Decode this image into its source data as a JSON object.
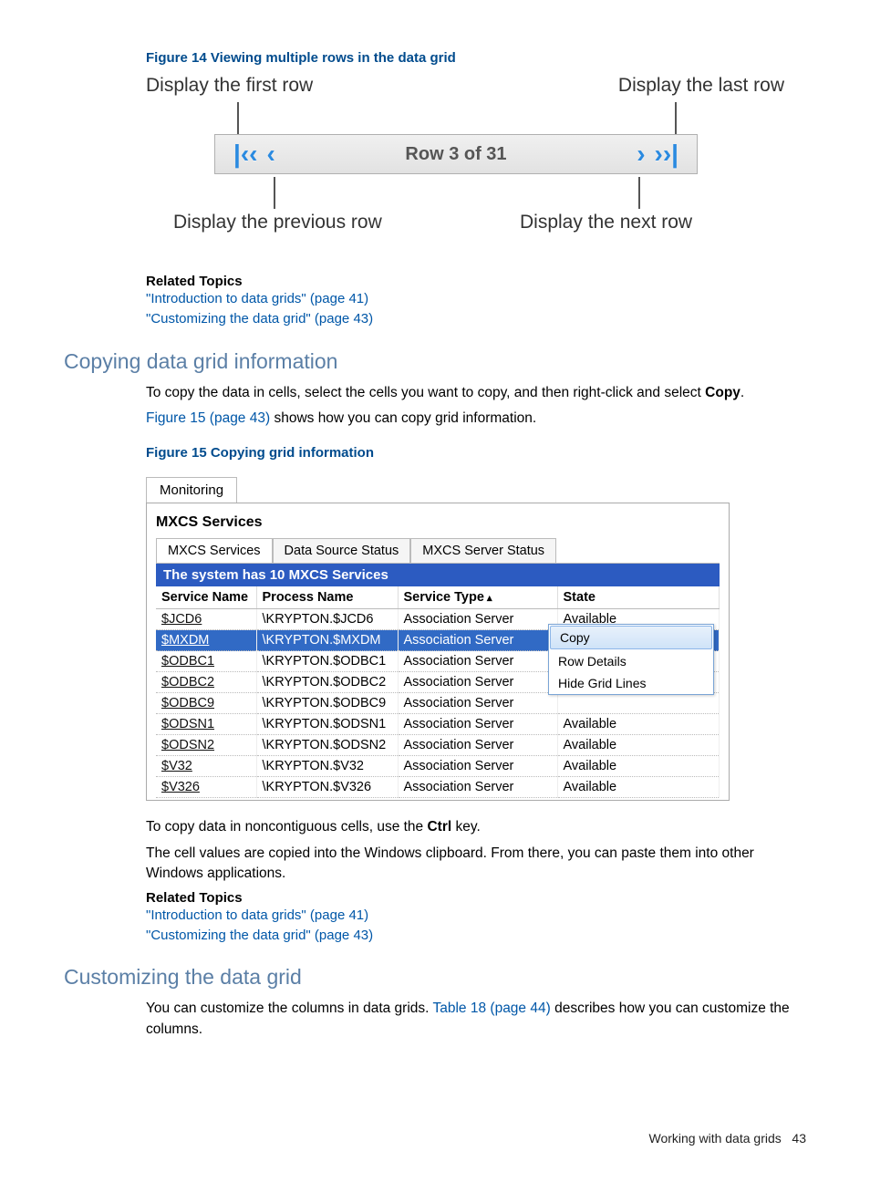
{
  "figure14": {
    "caption": "Figure 14 Viewing multiple rows in the data grid",
    "label_first": "Display the first row",
    "label_last": "Display the last row",
    "label_prev": "Display the previous row",
    "label_next": "Display the next row",
    "row_text": "Row 3 of 31"
  },
  "related1": {
    "heading": "Related Topics",
    "link1": "\"Introduction to data grids\" (page 41)",
    "link2": "\"Customizing the data grid\" (page 43)"
  },
  "section_copy": {
    "heading": "Copying data grid information",
    "para1_a": "To copy the data in cells, select the cells you want to copy, and then right-click and select ",
    "para1_b": "Copy",
    "para1_c": ".",
    "para2_a": "Figure 15 (page 43)",
    "para2_b": " shows how you can copy grid information."
  },
  "figure15": {
    "caption": "Figure 15 Copying grid information",
    "tab_main": "Monitoring",
    "panel_title": "MXCS Services",
    "subtabs": [
      "MXCS Services",
      "Data Source Status",
      "MXCS Server Status"
    ],
    "blue_bar": "The system has 10 MXCS Services",
    "columns": [
      "Service Name",
      "Process Name",
      "Service Type",
      "State"
    ],
    "rows": [
      {
        "svc": "$JCD6",
        "proc": "\\KRYPTON.$JCD6",
        "type": "Association Server",
        "state": "Available",
        "selected": false
      },
      {
        "svc": "$MXDM",
        "proc": "\\KRYPTON.$MXDM",
        "type": "Association Server",
        "state": "",
        "selected": true
      },
      {
        "svc": "$ODBC1",
        "proc": "\\KRYPTON.$ODBC1",
        "type": "Association Server",
        "state": "",
        "selected": false
      },
      {
        "svc": "$ODBC2",
        "proc": "\\KRYPTON.$ODBC2",
        "type": "Association Server",
        "state": "",
        "selected": false
      },
      {
        "svc": "$ODBC9",
        "proc": "\\KRYPTON.$ODBC9",
        "type": "Association Server",
        "state": "",
        "selected": false
      },
      {
        "svc": "$ODSN1",
        "proc": "\\KRYPTON.$ODSN1",
        "type": "Association Server",
        "state": "Available",
        "selected": false
      },
      {
        "svc": "$ODSN2",
        "proc": "\\KRYPTON.$ODSN2",
        "type": "Association Server",
        "state": "Available",
        "selected": false
      },
      {
        "svc": "$V32",
        "proc": "\\KRYPTON.$V32",
        "type": "Association Server",
        "state": "Available",
        "selected": false
      },
      {
        "svc": "$V326",
        "proc": "\\KRYPTON.$V326",
        "type": "Association Server",
        "state": "Available",
        "selected": false
      }
    ],
    "context_menu": [
      "Copy",
      "Row Details",
      "Hide Grid Lines"
    ],
    "col_widths": [
      "110px",
      "150px",
      "170px",
      "auto"
    ]
  },
  "after_fig15": {
    "para1_a": "To copy data in noncontiguous cells, use the ",
    "para1_b": "Ctrl",
    "para1_c": " key.",
    "para2": "The cell values are copied into the Windows clipboard. From there, you can paste them into other Windows applications."
  },
  "related2": {
    "heading": "Related Topics",
    "link1": "\"Introduction to data grids\" (page 41)",
    "link2": "\"Customizing the data grid\" (page 43)"
  },
  "section_custom": {
    "heading": "Customizing the data grid",
    "para_a": "You can customize the columns in data grids. ",
    "para_link": "Table 18 (page 44)",
    "para_b": " describes how you can customize the columns."
  },
  "footer": {
    "section": "Working with data grids",
    "page": "43"
  }
}
